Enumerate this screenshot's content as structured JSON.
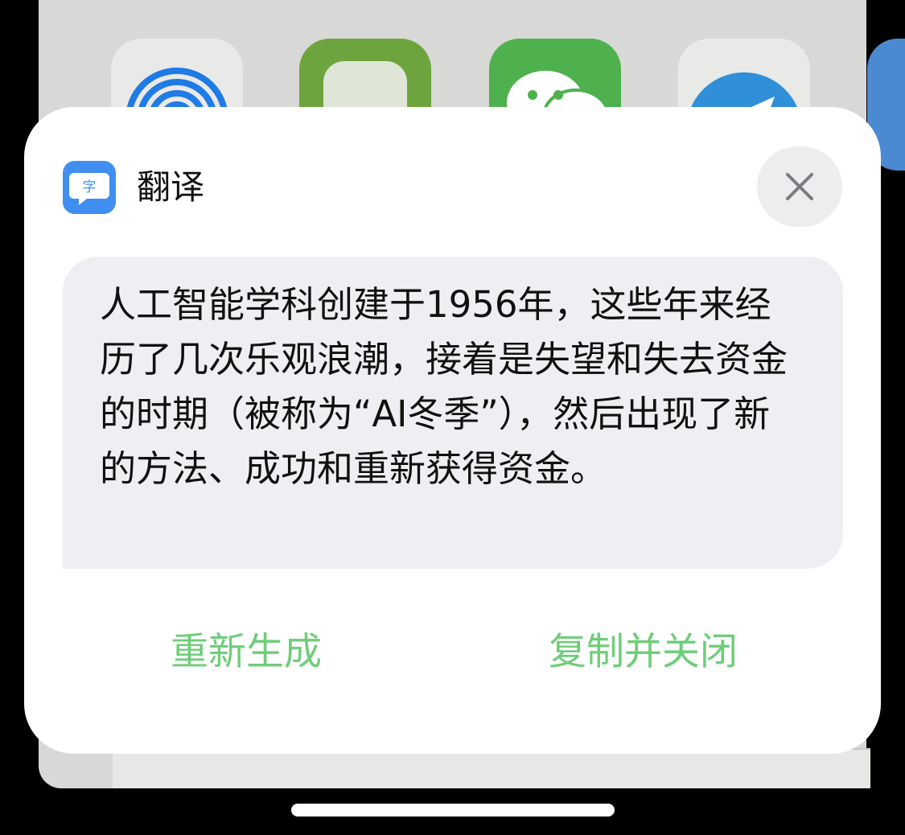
{
  "dialog": {
    "title": "翻译",
    "app_icon": "translate-char-icon",
    "app_icon_glyph": "字",
    "close_icon": "close-icon",
    "result_text": "人工智能学科创建于1956年，这些年来经历了几次乐观浪潮，接着是失望和失去资金的时期（被称为“AI冬季”），然后出现了新的方法、成功和重新获得资金。",
    "actions": {
      "regenerate_label": "重新生成",
      "copy_close_label": "复制并关闭"
    }
  },
  "share_sheet": {
    "apps": [
      "airdrop-icon",
      "app-icon-green",
      "wechat-icon",
      "telegram-icon",
      "app-icon-blue"
    ]
  },
  "colors": {
    "accent": "#6fcd7a",
    "app_icon_bg": "#3f8ef0",
    "result_bg": "#efeff3"
  }
}
